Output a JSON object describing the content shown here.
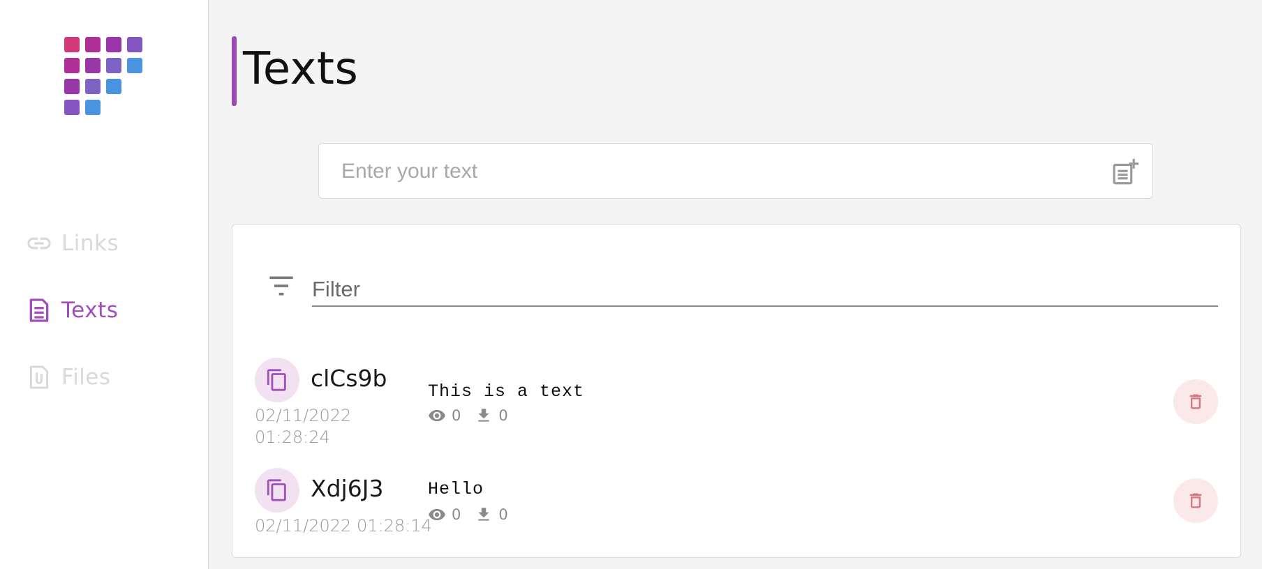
{
  "sidebar": {
    "nav": [
      {
        "label": "Links",
        "icon": "link-icon",
        "active": false
      },
      {
        "label": "Texts",
        "icon": "document-icon",
        "active": true
      },
      {
        "label": "Files",
        "icon": "paperclip-icon",
        "active": false
      }
    ]
  },
  "page": {
    "title": "Texts"
  },
  "new_text": {
    "placeholder": "Enter your text",
    "add_icon": "note-add-icon"
  },
  "filter": {
    "placeholder": "Filter",
    "icon": "filter-icon"
  },
  "texts": [
    {
      "code": "clCs9b",
      "date": "02/11/2022 01:28:24",
      "content": "This is a text",
      "views": "0",
      "downloads": "0"
    },
    {
      "code": "Xdj6J3",
      "date": "02/11/2022 01:28:14",
      "content": "Hello",
      "views": "0",
      "downloads": "0"
    }
  ],
  "colors": {
    "accent": "#9b4bb3",
    "background": "#f4f4f4",
    "copy_bg": "#f1e1f1",
    "delete_bg": "#fbe9ea",
    "delete_icon": "#d9747c"
  }
}
